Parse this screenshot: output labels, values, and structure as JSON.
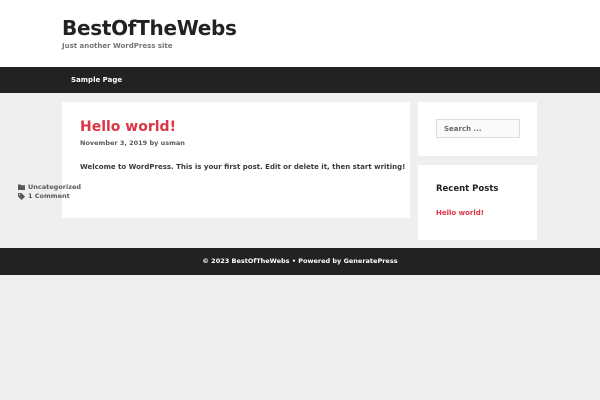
{
  "site": {
    "title": "BestOfTheWebs",
    "tagline": "Just another WordPress site"
  },
  "nav": {
    "items": [
      {
        "label": "Sample Page"
      }
    ]
  },
  "post": {
    "title": "Hello world!",
    "date": "November 3, 2019",
    "by": "by",
    "author": "usman",
    "content": "Welcome to WordPress. This is your first post. Edit or delete it, then start writing!",
    "category": "Uncategorized",
    "comments": "1 Comment"
  },
  "sidebar": {
    "search_placeholder": "Search ...",
    "recent_title": "Recent Posts",
    "recent_items": [
      {
        "label": "Hello world!"
      }
    ]
  },
  "footer": {
    "copyright": "© 2023 BestOfTheWebs • Powered by",
    "powered_link": "GeneratePress"
  },
  "colors": {
    "accent": "#dc3545",
    "dark_bar": "#222222",
    "page_bg": "#efefef"
  },
  "icons": {
    "category": "folder-icon",
    "comments": "tag-icon"
  }
}
